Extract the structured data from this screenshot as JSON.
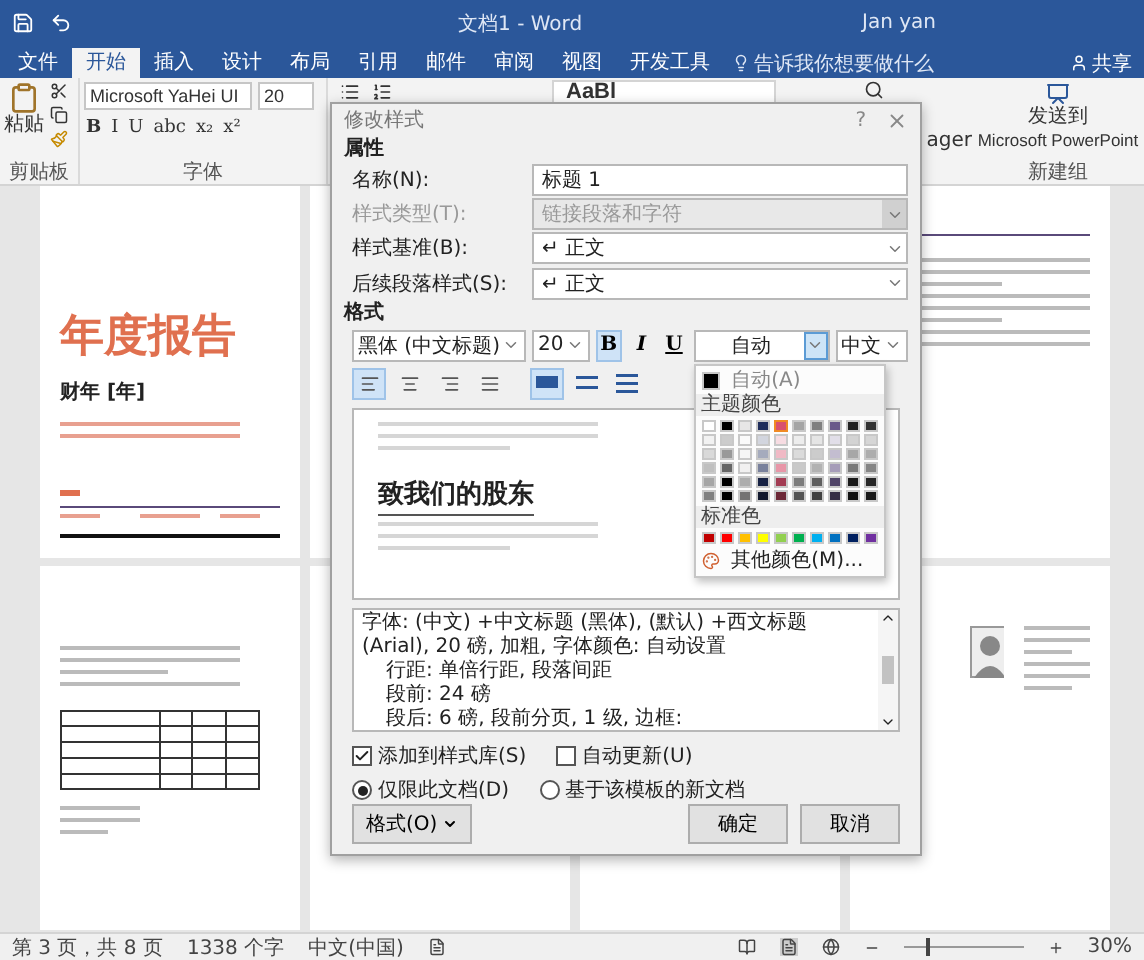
{
  "window": {
    "title": "文档1 - Word",
    "user": "Jan yan"
  },
  "tabs": [
    {
      "label": "文件",
      "selected": false
    },
    {
      "label": "开始",
      "selected": true
    },
    {
      "label": "插入",
      "selected": false
    },
    {
      "label": "设计",
      "selected": false
    },
    {
      "label": "布局",
      "selected": false
    },
    {
      "label": "引用",
      "selected": false
    },
    {
      "label": "邮件",
      "selected": false
    },
    {
      "label": "审阅",
      "selected": false
    },
    {
      "label": "视图",
      "selected": false
    },
    {
      "label": "开发工具",
      "selected": false
    }
  ],
  "tell_me": {
    "placeholder": "告诉我你想要做什么"
  },
  "share_button": "共享",
  "ribbon": {
    "paste": "粘贴",
    "font_name": "Microsoft YaHei UI",
    "font_size": "20",
    "format_buttons": [
      "B",
      "I",
      "U",
      "abc",
      "x₂",
      "x²"
    ],
    "styles_preview": "AaBl",
    "cut_label": "ager",
    "send_line1": "发送到",
    "send_line2": "Microsoft PowerPoint",
    "groups": [
      "剪贴板",
      "字体",
      "新建组"
    ]
  },
  "pages": [
    {
      "kind": "cover",
      "title": "年度报告",
      "subtitle": "财年 [年]"
    },
    {
      "kind": "blank"
    },
    {
      "kind": "covered"
    },
    {
      "kind": "headings"
    },
    {
      "kind": "table"
    },
    {
      "kind": "blank"
    },
    {
      "kind": "blank"
    },
    {
      "kind": "profile"
    }
  ],
  "dialog": {
    "title": "修改样式",
    "help": "?",
    "properties_heading": "属性",
    "fields": [
      {
        "label": "名称(N):",
        "value": "标题 1",
        "kind": "text",
        "disabled": false
      },
      {
        "label": "样式类型(T):",
        "value": "链接段落和字符",
        "kind": "select",
        "disabled": true
      },
      {
        "label": "样式基准(B):",
        "value": "↵ 正文",
        "kind": "select",
        "disabled": false
      },
      {
        "label": "后续段落样式(S):",
        "value": "↵ 正文",
        "kind": "select",
        "disabled": false
      }
    ],
    "format_heading": "格式",
    "font": "黑体 (中文标题)",
    "size": "20",
    "style_buttons": [
      {
        "label": "B",
        "on": true
      },
      {
        "label": "I",
        "on": false
      },
      {
        "label": "U",
        "on": false
      }
    ],
    "color": {
      "value": "自动",
      "expanded": true
    },
    "script": "中文",
    "align_buttons": [
      {
        "kind": "left",
        "selected": true
      },
      {
        "kind": "center",
        "selected": false
      },
      {
        "kind": "right",
        "selected": false
      },
      {
        "kind": "justify",
        "selected": false
      }
    ],
    "spacing_buttons": [
      {
        "kind": "single",
        "selected": true
      },
      {
        "kind": "one-half",
        "selected": false
      },
      {
        "kind": "double",
        "selected": false
      }
    ],
    "preview_heading": "致我们的股东",
    "description": [
      "字体: (中文) +中文标题 (黑体), (默认) +西文标题 (Arial), 20 磅, 加粗, 字体颜色: 自动设置",
      "行距: 单倍行距, 段落间距",
      "段前: 24 磅",
      "段后: 6 磅, 段前分页, 1 级, 边框:"
    ],
    "options": [
      {
        "label": "添加到样式库(S)",
        "checked": true
      },
      {
        "label": "自动更新(U)",
        "checked": false
      }
    ],
    "scope": [
      {
        "label": "仅限此文档(D)",
        "selected": true
      },
      {
        "label": "基于该模板的新文档",
        "selected": false
      }
    ],
    "format_menu": "格式(O)",
    "ok": "确定",
    "cancel": "取消"
  },
  "color_menu": {
    "auto": "自动(A)",
    "theme_heading": "主题颜色",
    "theme_colors": [
      {
        "color": "#ffffff",
        "selected": false
      },
      {
        "color": "#000000",
        "selected": false
      },
      {
        "color": "#e7e6e6",
        "selected": false
      },
      {
        "color": "#1f2d5a",
        "selected": false
      },
      {
        "color": "#d9506e",
        "selected": true
      },
      {
        "color": "#a5a5a5",
        "selected": false
      },
      {
        "color": "#7f7f7f",
        "selected": false
      },
      {
        "color": "#6a5a8a",
        "selected": false
      },
      {
        "color": "#222222",
        "selected": false
      },
      {
        "color": "#333333",
        "selected": false
      }
    ],
    "standard_heading": "标准色",
    "standard_colors": [
      {
        "color": "#c00000"
      },
      {
        "color": "#ff0000"
      },
      {
        "color": "#ffc000"
      },
      {
        "color": "#ffff00"
      },
      {
        "color": "#92d050"
      },
      {
        "color": "#00b050"
      },
      {
        "color": "#00b0f0"
      },
      {
        "color": "#0070c0"
      },
      {
        "color": "#002060"
      },
      {
        "color": "#7030a0"
      }
    ],
    "more": "其他颜色(M)..."
  },
  "status_bar": {
    "page": "第 3 页，共 8 页",
    "words": "1338 个字",
    "language": "中文(中国)",
    "zoom": "30%",
    "zoom_slider": {
      "level": 0.18
    }
  }
}
